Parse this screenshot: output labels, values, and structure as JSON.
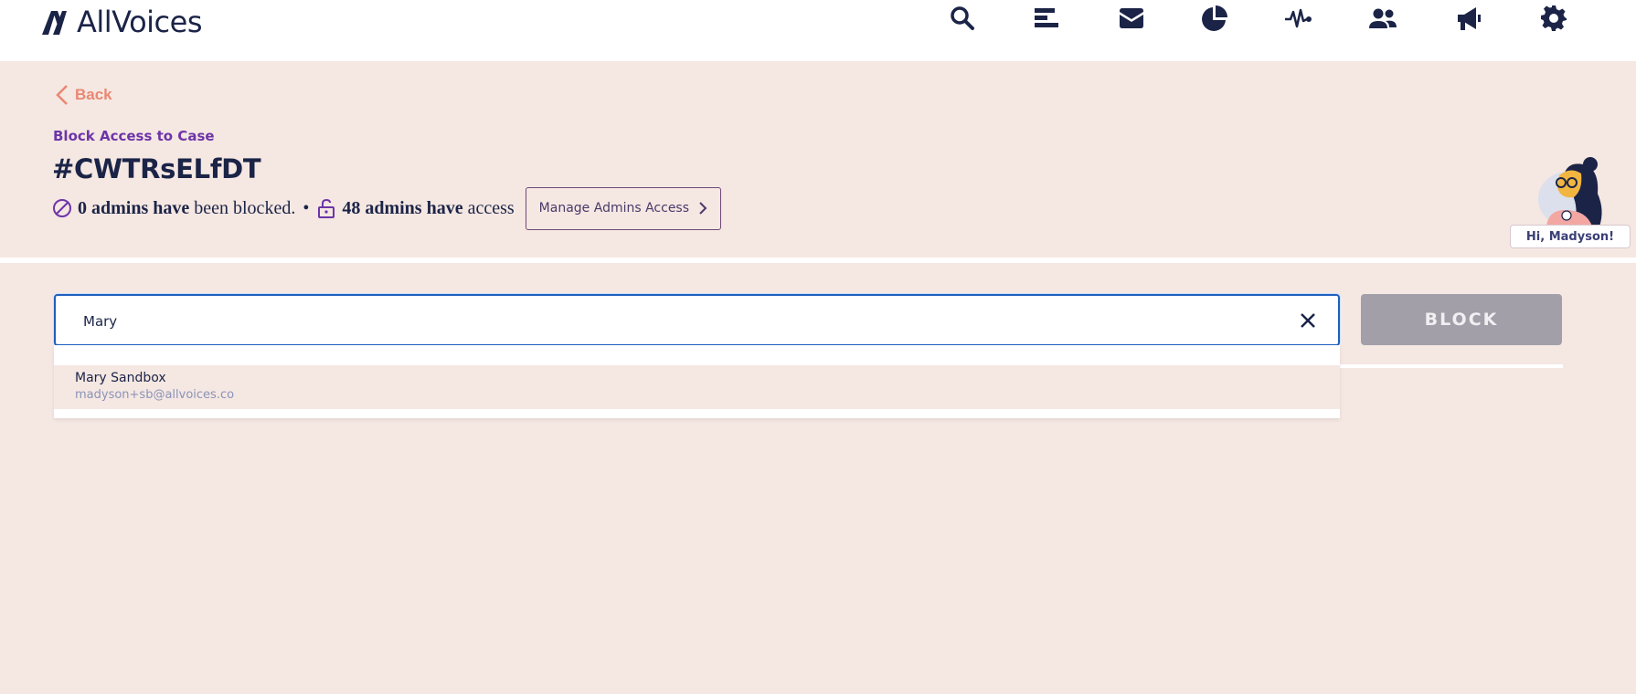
{
  "brand": {
    "name": "AllVoices"
  },
  "nav": {
    "icons": [
      "search-icon",
      "reports-icon",
      "inbox-icon",
      "analytics-icon",
      "activity-icon",
      "users-icon",
      "announcements-icon",
      "settings-icon"
    ]
  },
  "header": {
    "back_label": "Back",
    "eyebrow": "Block Access to Case",
    "case_id": "#CWTRsELfDT",
    "blocked_count": "0 admins have",
    "blocked_text": "been blocked.",
    "separator": "•",
    "access_count": "48 admins have",
    "access_text": "access",
    "manage_button": "Manage Admins Access"
  },
  "user": {
    "greeting": "Hi, Madyson!"
  },
  "search": {
    "value": "Mary",
    "placeholder": ""
  },
  "block_button": "BLOCK",
  "dropdown": {
    "options": [
      {
        "name": "Mary Sandbox",
        "email": "madyson+sb@allvoices.co"
      }
    ]
  },
  "colors": {
    "background": "#f5e7e2",
    "navy": "#1b2447",
    "accent_coral": "#e98873",
    "accent_purple": "#6d35a8",
    "focus_blue": "#1f5fc0",
    "disabled_button": "#a29fa9"
  }
}
